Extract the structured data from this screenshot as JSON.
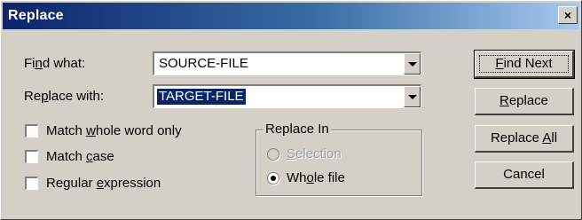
{
  "window": {
    "title": "Replace",
    "close_glyph": "×"
  },
  "find": {
    "label_pre": "Fi",
    "label_key": "n",
    "label_post": "d what:",
    "value": "SOURCE-FILE"
  },
  "replace_with": {
    "label_pre": "Re",
    "label_key": "p",
    "label_post": "lace with:",
    "value": "TARGET-FILE"
  },
  "options": {
    "whole_word": {
      "pre": "Match ",
      "key": "w",
      "post": "hole word only",
      "checked": false
    },
    "match_case": {
      "pre": "Match ",
      "key": "c",
      "post": "ase",
      "checked": false
    },
    "regex": {
      "pre": "Regular ",
      "key": "e",
      "post": "xpression",
      "checked": false
    }
  },
  "replace_in": {
    "title": "Replace In",
    "selection": {
      "pre": "",
      "key": "S",
      "post": "election",
      "enabled": false
    },
    "whole_file": {
      "pre": "Wh",
      "key": "o",
      "post": "le file",
      "selected": true
    }
  },
  "buttons": {
    "find_next": {
      "pre": "",
      "key": "F",
      "post": "ind Next"
    },
    "replace": {
      "pre": "",
      "key": "R",
      "post": "eplace"
    },
    "replace_all": {
      "pre": "Replace ",
      "key": "A",
      "post": "ll"
    },
    "cancel": {
      "pre": "Cancel",
      "key": "",
      "post": ""
    }
  },
  "icons": {
    "close": "close-icon",
    "dropdown": "chevron-down-icon"
  }
}
